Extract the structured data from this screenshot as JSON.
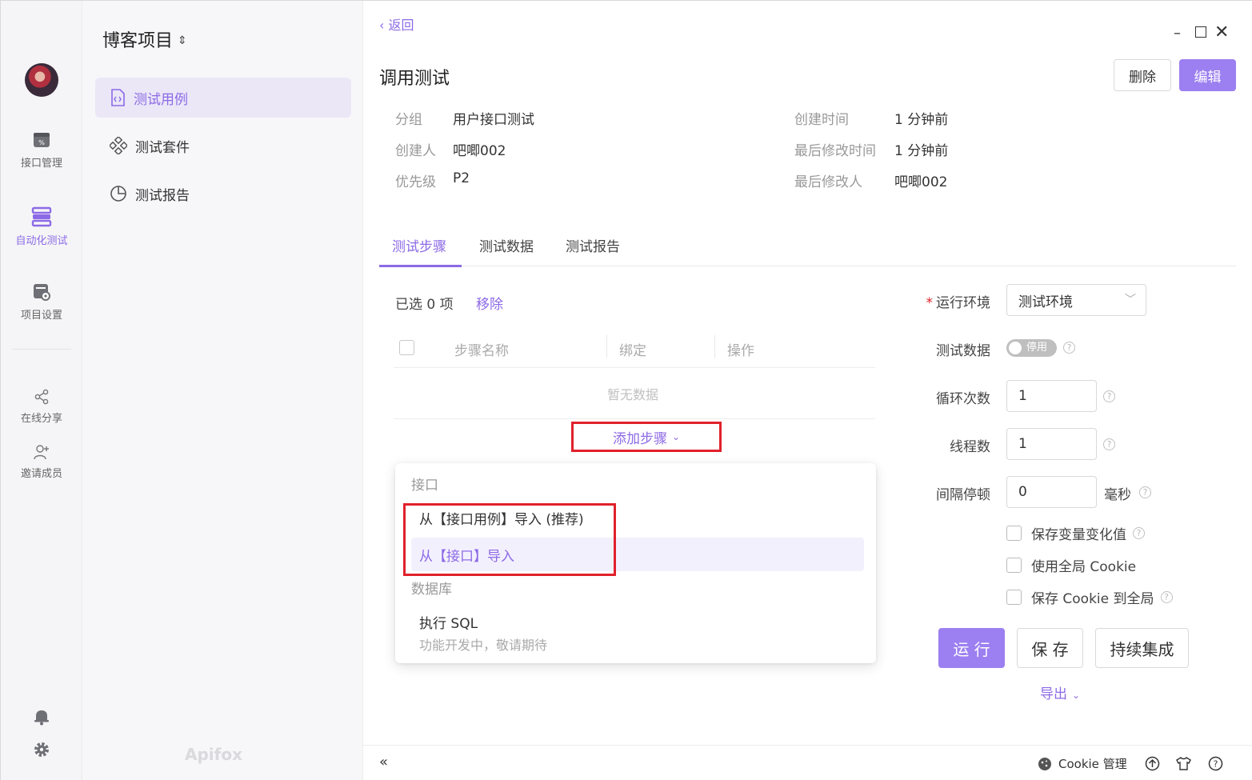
{
  "rail": {
    "items": [
      {
        "label": "接口管理",
        "icon": "api-management-icon",
        "active": false
      },
      {
        "label": "自动化测试",
        "icon": "automation-test-icon",
        "active": true
      },
      {
        "label": "项目设置",
        "icon": "project-settings-icon",
        "active": false
      },
      {
        "label": "在线分享",
        "icon": "share-icon",
        "active": false
      },
      {
        "label": "邀请成员",
        "icon": "invite-member-icon",
        "active": false
      }
    ]
  },
  "sidebar": {
    "project_name": "博客项目",
    "items": [
      {
        "label": "测试用例",
        "active": true
      },
      {
        "label": "测试套件",
        "active": false
      },
      {
        "label": "测试报告",
        "active": false
      }
    ],
    "watermark": "Apifox"
  },
  "header": {
    "back": "返回",
    "title": "调用测试",
    "delete": "删除",
    "edit": "编辑"
  },
  "meta": {
    "group_label": "分组",
    "group_value": "用户接口测试",
    "creator_label": "创建人",
    "creator_value": "吧唧002",
    "priority_label": "优先级",
    "priority_value": "P2",
    "created_label": "创建时间",
    "created_value": "1 分钟前",
    "modified_label": "最后修改时间",
    "modified_value": "1 分钟前",
    "modifier_label": "最后修改人",
    "modifier_value": "吧唧002"
  },
  "tabs": [
    {
      "label": "测试步骤",
      "active": true
    },
    {
      "label": "测试数据",
      "active": false
    },
    {
      "label": "测试报告",
      "active": false
    }
  ],
  "steps": {
    "selected": "已选 0 项",
    "remove": "移除",
    "columns": [
      "步骤名称",
      "绑定",
      "操作"
    ],
    "empty": "暂无数据",
    "add_step": "添加步骤"
  },
  "dropdown": {
    "group1": "接口",
    "item1": "从【接口用例】导入 (推荐)",
    "item2": "从【接口】导入",
    "group2": "数据库",
    "item3": "执行 SQL",
    "item3_sub": "功能开发中，敬请期待"
  },
  "config": {
    "env_label": "运行环境",
    "env_value": "测试环境",
    "data_label": "测试数据",
    "data_toggle": "停用",
    "loop_label": "循环次数",
    "loop_value": "1",
    "thread_label": "线程数",
    "thread_value": "1",
    "interval_label": "间隔停顿",
    "interval_value": "0",
    "interval_unit": "毫秒",
    "cb1": "保存变量变化值",
    "cb2": "使用全局 Cookie",
    "cb3": "保存 Cookie 到全局",
    "run": "运 行",
    "save": "保 存",
    "ci": "持续集成",
    "export": "导出"
  },
  "footer": {
    "cookie": "Cookie 管理"
  },
  "colors": {
    "accent": "#8c6ae6",
    "primary_button": "#9c7ff0",
    "highlight_box": "#e0212b"
  }
}
